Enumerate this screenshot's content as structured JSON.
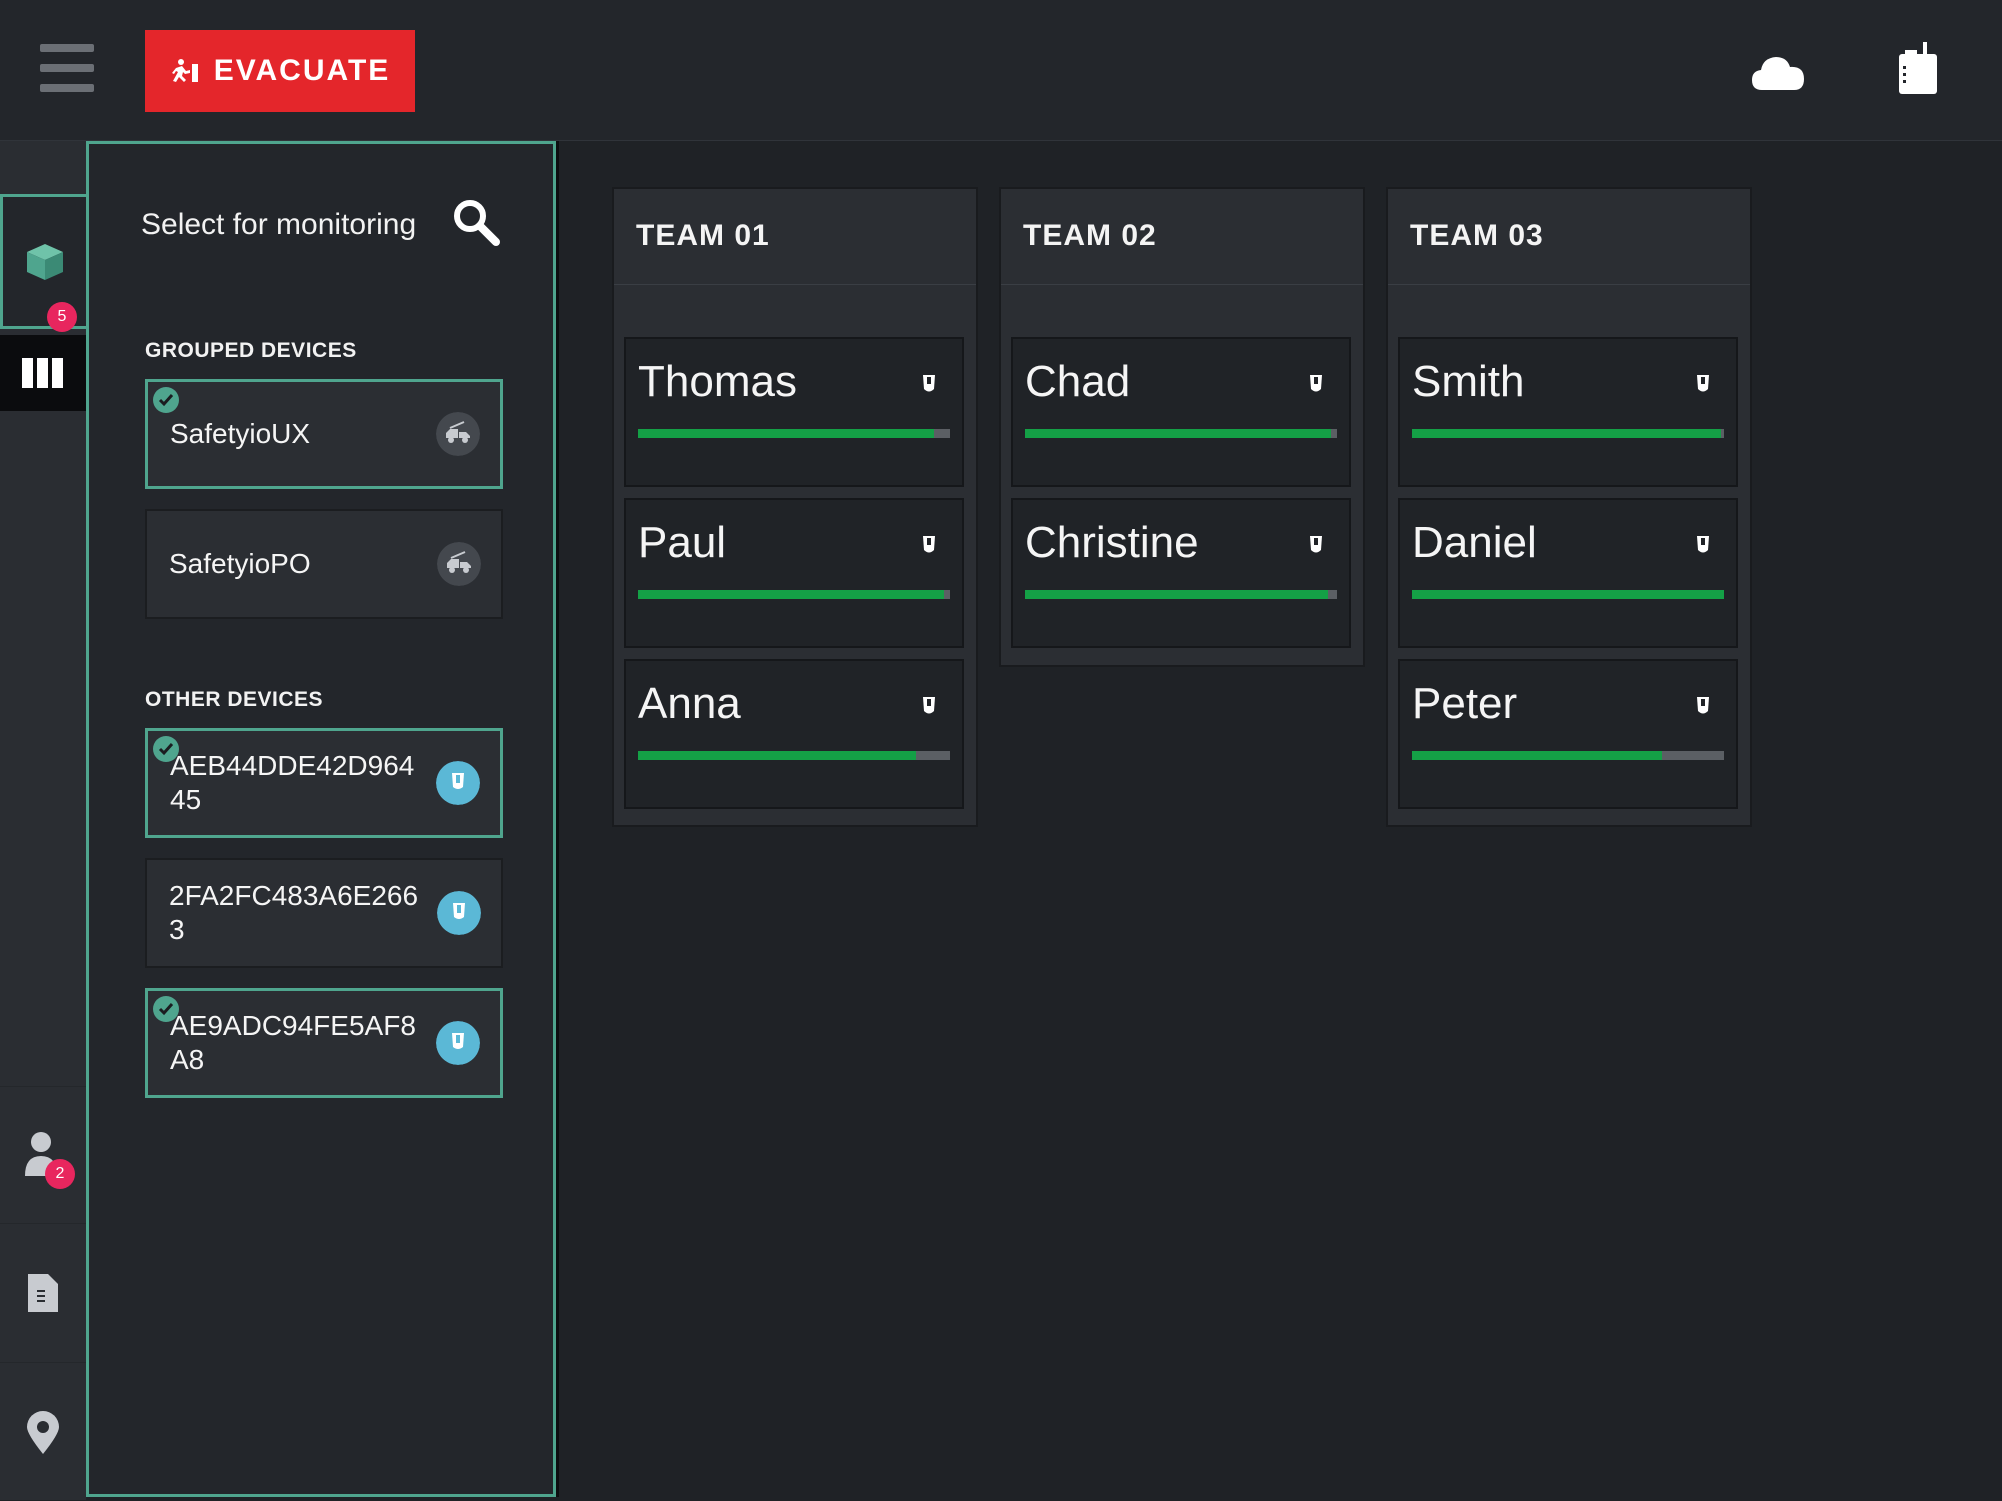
{
  "header": {
    "evacuate_label": "EVACUATE",
    "icons": [
      "menu-icon",
      "evacuate-icon",
      "cloud-icon",
      "radio-icon"
    ],
    "accent": "#e4262b"
  },
  "rail": {
    "devices_badge": "5",
    "users_badge": "2",
    "icons": [
      "devices-icon",
      "board-icon",
      "user-icon",
      "document-icon",
      "location-icon"
    ]
  },
  "panel": {
    "title": "Select for monitoring",
    "grouped_label": "GROUPED DEVICES",
    "other_label": "OTHER DEVICES",
    "grouped": [
      {
        "name": "SafetyioUX",
        "selected": true
      },
      {
        "name": "SafetyioPO",
        "selected": false
      }
    ],
    "other": [
      {
        "name": "AEB44DDE42D964 45",
        "selected": true
      },
      {
        "name": "2FA2FC483A6E266 3",
        "selected": false
      },
      {
        "name": "AE9ADC94FE5AF8 A8",
        "selected": true
      }
    ],
    "accent": "#4fa58e"
  },
  "teams": [
    {
      "title": "TEAM 01",
      "members": [
        {
          "name": "Thomas",
          "level": 0.95
        },
        {
          "name": "Paul",
          "level": 0.98
        },
        {
          "name": "Anna",
          "level": 0.89
        }
      ]
    },
    {
      "title": "TEAM 02",
      "members": [
        {
          "name": "Chad",
          "level": 0.98
        },
        {
          "name": "Christine",
          "level": 0.97
        }
      ]
    },
    {
      "title": "TEAM 03",
      "members": [
        {
          "name": "Smith",
          "level": 0.99
        },
        {
          "name": "Daniel",
          "level": 1.0
        },
        {
          "name": "Peter",
          "level": 0.8
        }
      ]
    }
  ],
  "bar_color": "#14a046"
}
